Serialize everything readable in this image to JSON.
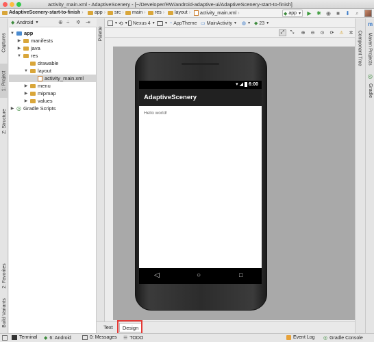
{
  "window": {
    "title": "activity_main.xml - AdaptiveScenery - [~/Developer/RW/android-adaptive-ui/AdaptiveScenery-start-to-finish]"
  },
  "breadcrumbs": [
    "AdaptiveScenery-start-to-finish",
    "app",
    "src",
    "main",
    "res",
    "layout",
    "activity_main.xml"
  ],
  "run_config": {
    "label": "app"
  },
  "left_tabs": {
    "captures": "Captures",
    "project": "1: Project",
    "structure": "Z: Structure",
    "favorites": "2: Favorites",
    "build_variants": "Build Variants"
  },
  "right_tabs": {
    "maven": "Maven Projects",
    "gradle": "Gradle"
  },
  "project_panel": {
    "view_selector": "Android",
    "tree": [
      {
        "label": "app"
      },
      {
        "label": "manifests"
      },
      {
        "label": "java"
      },
      {
        "label": "res"
      },
      {
        "label": "drawable"
      },
      {
        "label": "layout"
      },
      {
        "label": "activity_main.xml"
      },
      {
        "label": "menu"
      },
      {
        "label": "mipmap"
      },
      {
        "label": "values"
      },
      {
        "label": "Gradle Scripts"
      }
    ]
  },
  "palette_tab": "Palette",
  "component_tree_tab": "Component Tree",
  "editor_toolbar": {
    "device": "Nexus 4",
    "theme": "AppTheme",
    "activity": "MainActivity",
    "api_level": "23"
  },
  "phone": {
    "time": "6:00",
    "app_title": "AdaptiveScenery",
    "content_text": "Hello world!"
  },
  "editor_tabs": {
    "text": "Text",
    "design": "Design"
  },
  "bottom_bar": {
    "terminal": "Terminal",
    "android": "6: Android",
    "messages": "0: Messages",
    "todo": "TODO",
    "event_log": "Event Log",
    "gradle_console": "Gradle Console"
  },
  "colors": {
    "highlight_box": "#e53935",
    "action_bar": "#212121",
    "canvas": "#a9a9a9"
  }
}
